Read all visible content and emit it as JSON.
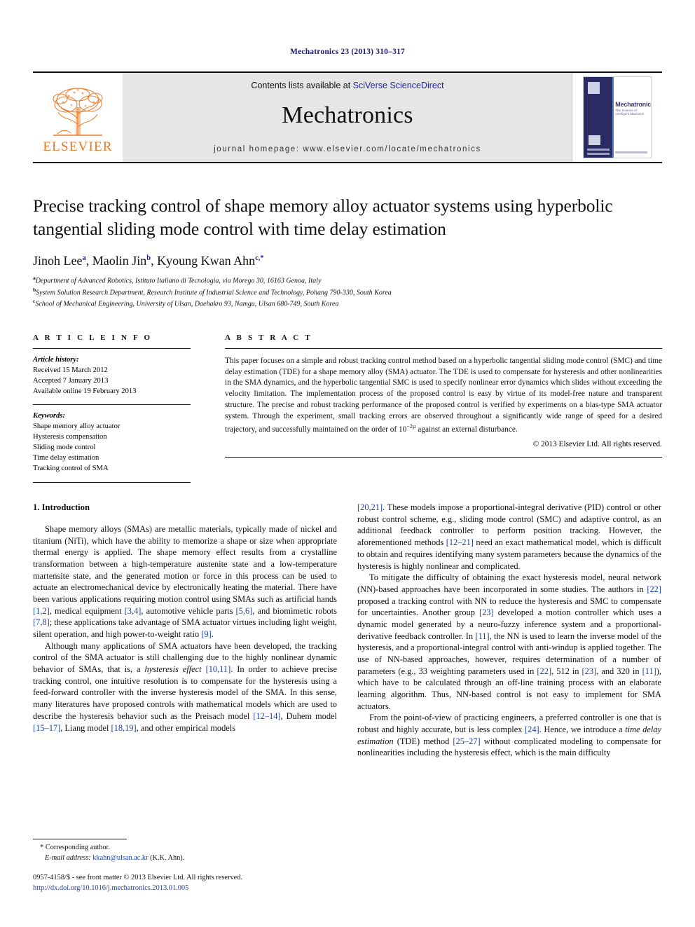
{
  "running_head": "Mechatronics 23 (2013) 310–317",
  "masthead": {
    "publisher_logo_label": "ELSEVIER",
    "contents_prefix": "Contents lists available at ",
    "contents_link": "SciVerse ScienceDirect",
    "journal_name": "Mechatronics",
    "homepage_prefix": "journal homepage: ",
    "homepage_url": "www.elsevier.com/locate/mechatronics",
    "cover": {
      "title": "Mechatronics",
      "subtitle": "The Science of Intelligent Machines"
    }
  },
  "article": {
    "title": "Precise tracking control of shape memory alloy actuator systems using hyperbolic tangential sliding mode control with time delay estimation",
    "authors": [
      {
        "name": "Jinoh Lee",
        "marks": "a"
      },
      {
        "name": "Maolin Jin",
        "marks": "b"
      },
      {
        "name": "Kyoung Kwan Ahn",
        "marks": "c,*"
      }
    ],
    "affiliations": [
      {
        "mark": "a",
        "text": "Department of Advanced Robotics, Istituto Italiano di Tecnologia, via Morego 30, 16163 Genoa, Italy"
      },
      {
        "mark": "b",
        "text": "System Solution Research Department, Research Institute of Industrial Science and Technology, Pohang 790-330, South Korea"
      },
      {
        "mark": "c",
        "text": "School of Mechanical Engineering, University of Ulsan, Daehakro 93, Namgu, Ulsan 680-749, South Korea"
      }
    ]
  },
  "article_info": {
    "heading": "A R T I C L E   I N F O",
    "history_label": "Article history:",
    "history": [
      "Received 15 March 2012",
      "Accepted 7 January 2013",
      "Available online 19 February 2013"
    ],
    "keywords_label": "Keywords:",
    "keywords": [
      "Shape memory alloy actuator",
      "Hysteresis compensation",
      "Sliding mode control",
      "Time delay estimation",
      "Tracking control of SMA"
    ]
  },
  "abstract": {
    "heading": "A B S T R A C T",
    "text_part1": "This paper focuses on a simple and robust tracking control method based on a hyperbolic tangential sliding mode control (SMC) and time delay estimation (TDE) for a shape memory alloy (SMA) actuator. The TDE is used to compensate for hysteresis and other nonlinearities in the SMA dynamics, and the hyperbolic tangential SMC is used to specify nonlinear error dynamics which slides without exceeding the velocity limitation. The implementation process of the proposed control is easy by virtue of its model-free nature and transparent structure. The precise and robust tracking performance of the proposed control is verified by experiments on a bias-type SMA actuator system. Through the experiment, small tracking errors are observed throughout a significantly wide range of speed for a desired trajectory, and successfully maintained on the order of 10",
    "superscript": "−2µ",
    "text_part2": " against an external disturbance.",
    "copyright": "© 2013 Elsevier Ltd. All rights reserved."
  },
  "body": {
    "section_number_title": "1. Introduction",
    "left_column": {
      "p1_a": "Shape memory alloys (SMAs) are metallic materials, typically made of nickel and titanium (NiTi), which have the ability to memorize a shape or size when appropriate thermal energy is applied. The shape memory effect results from a crystalline transformation between a high-temperature austenite state and a low-temperature martensite state, and the generated motion or force in this process can be used to actuate an electromechanical device by electronically heating the material. There have been various applications requiring motion control using SMAs such as artificial hands ",
      "c1": "[1,2]",
      "p1_b": ", medical equipment ",
      "c2": "[3,4]",
      "p1_c": ", automotive vehicle parts ",
      "c3": "[5,6]",
      "p1_d": ", and biomimetic robots ",
      "c4": "[7,8]",
      "p1_e": "; these applications take advantage of SMA actuator virtues including light weight, silent operation, and high power-to-weight ratio ",
      "c5": "[9]",
      "p1_f": ".",
      "p2_a": "Although many applications of SMA actuators have been developed, the tracking control of the SMA actuator is still challenging due to the highly nonlinear dynamic behavior of SMAs, that is, a ",
      "i1": "hysteresis effect",
      "p2_b": " ",
      "c6": "[10,11]",
      "p2_c": ". In order to achieve precise tracking control, one intuitive resolution is to compensate for the hysteresis using a feed-forward controller with the inverse hysteresis model of the SMA. In this sense, many literatures have proposed controls with mathematical models which are used to describe the hysteresis behavior such as the Preisach model ",
      "c7": "[12–14]",
      "p2_d": ", Duhem model ",
      "c8": "[15–17]",
      "p2_e": ", Liang model ",
      "c9": "[18,19]",
      "p2_f": ", and other empirical models"
    },
    "right_column": {
      "c10": "[20,21]",
      "p3_a": ". These models impose a proportional-integral derivative (PID) control or other robust control scheme, e.g., sliding mode control (SMC) and adaptive control, as an additional feedback controller to perform position tracking. However, the aforementioned methods ",
      "c11": "[12–21]",
      "p3_b": " need an exact mathematical model, which is difficult to obtain and requires identifying many system parameters because the dynamics of the hysteresis is highly nonlinear and complicated.",
      "p4_a": "To mitigate the difficulty of obtaining the exact hysteresis model, neural network (NN)-based approaches have been incorporated in some studies. The authors in ",
      "c12": "[22]",
      "p4_b": " proposed a tracking control with NN to reduce the hysteresis and SMC to compensate for uncertainties. Another group ",
      "c13": "[23]",
      "p4_c": " developed a motion controller which uses a dynamic model generated by a neuro-fuzzy inference system and a proportional-derivative feedback controller. In ",
      "c14": "[11]",
      "p4_d": ", the NN is used to learn the inverse model of the hysteresis, and a proportional-integral control with anti-windup is applied together. The use of NN-based approaches, however, requires determination of a number of parameters (e.g., 33 weighting parameters used in ",
      "c15": "[22]",
      "p4_e": ", 512 in ",
      "c16": "[23]",
      "p4_f": ", and 320 in ",
      "c17": "[11]",
      "p4_g": "), which have to be calculated through an off-line training process with an elaborate learning algorithm. Thus, NN-based control is not easy to implement for SMA actuators.",
      "p5_a": "From the point-of-view of practicing engineers, a preferred controller is one that is robust and highly accurate, but is less complex ",
      "c18": "[24]",
      "p5_b": ". Hence, we introduce a ",
      "i2": "time delay estimation",
      "p5_c": " (TDE) method ",
      "c19": "[25–27]",
      "p5_d": " without complicated modeling to compensate for nonlinearities including the hysteresis effect, which is the main difficulty"
    }
  },
  "footer": {
    "corresponding_star": "*",
    "corresponding_text": " Corresponding author.",
    "email_label": "E-mail address:",
    "email": "kkahn@ulsan.ac.kr",
    "email_owner": " (K.K. Ahn).",
    "issn_line": "0957-4158/$ - see front matter © 2013 Elsevier Ltd. All rights reserved.",
    "doi": "http://dx.doi.org/10.1016/j.mechatronics.2013.01.005"
  }
}
